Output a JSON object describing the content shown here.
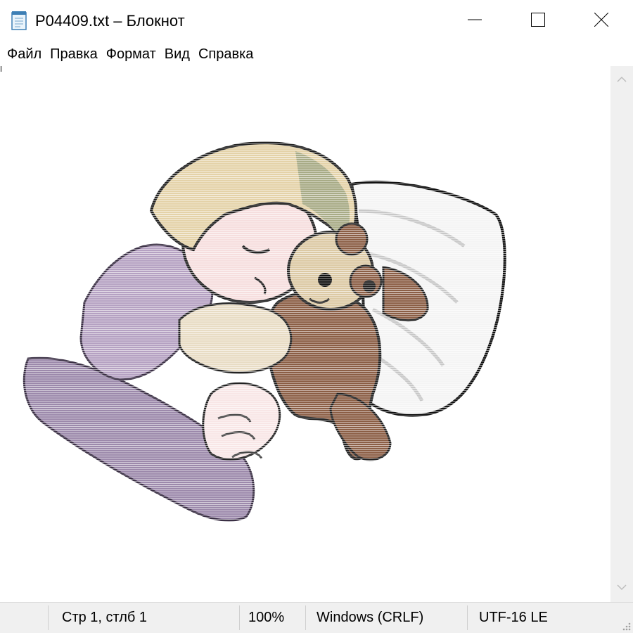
{
  "window": {
    "title": "P04409.txt – Блокнот",
    "icon": "notepad-icon",
    "controls": [
      "minimize-icon",
      "maximize-icon",
      "close-icon"
    ]
  },
  "menu": {
    "items": [
      "Файл",
      "Правка",
      "Формат",
      "Вид",
      "Справка"
    ]
  },
  "editor": {
    "content_image": "child-sleeping-with-teddy-bear-illustration"
  },
  "status": {
    "position": "Стр 1, стлб 1",
    "zoom": "100%",
    "line_endings": "Windows (CRLF)",
    "encoding": "UTF-16 LE"
  },
  "colors": {
    "background": "#ffffff",
    "chrome": "#f0f0f0",
    "bear": "#8b5e45",
    "shirt": "#a893b5",
    "hair": "#e2cfa3"
  }
}
